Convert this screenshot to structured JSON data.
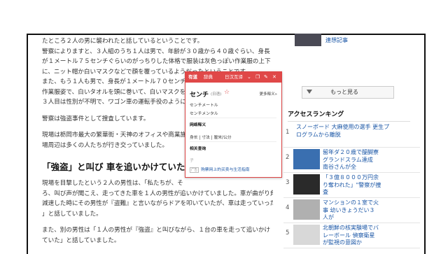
{
  "article": {
    "paragraphs": [
      [
        "たところ２人の男に襲われたと話しているということです。",
        "警察によりますと、３人組のうち１人は男で、年齢が３０歳から４０歳ぐらい、身長",
        "が１メートル７５センチぐらいのがっちりした体格で服装は灰色っぽい作業服の上下",
        "に、ニット帽か白いマスクなどで顔を覆っているようだったということです。",
        "また、もう１人も男で、身長が１メートル７０センチ",
        "作業服姿で、白いタオルを頭に巻いて、白いマスクを",
        "３人目は性別が不明で、ワゴン車の運転手役のように"
      ],
      [
        "警察は強盗事件として捜査しています。"
      ],
      [
        "現場は栃岡市最大の繁華街・天神のオフィスや商業施",
        "場周辺は多くの人たちが行き交っていました。"
      ]
    ],
    "heading": "「強盗」と叫び 車を追いかけていた",
    "paragraphs2": [
      [
        "現場を目撃したという２人の男性は、「私たちが、そ",
        "ろ、叫び声が聞こえ、走ってきた車を１人の男性が追いかけていました。車が曲がり角で",
        "減速した時にその男性が『盗難』と言いながらドアを叩いていたが、車は走っていった",
        "」と話していました。"
      ],
      [
        "また、別の男性は「１人の男性が『強盗』と叫びながら、１台の車を走って追いかけ",
        "ていた」と話していました。"
      ]
    ]
  },
  "sidebar": {
    "top_item_text": "連想記事",
    "more_button": "もっと見る",
    "ranking_title": "アクセスランキング",
    "ranking": [
      {
        "num": "1",
        "text": "スノーボード 大麻使用の選手 更生プ\nログラムから離脱",
        "has_image": false,
        "color": "#ffffff"
      },
      {
        "num": "2",
        "text": "留年ダ２０歳で醍醐寮\nグランドスラム達成\n南谷さんが全",
        "has_image": true,
        "color": "#3a6fb0"
      },
      {
        "num": "3",
        "text": "「３億８０００万円余\nり奪われた」\"警察が捜\n査",
        "has_image": true,
        "color": "#2a2a2a"
      },
      {
        "num": "4",
        "text": "マンションの１室で火\n事 幼いきょうだい３\n人が",
        "has_image": true,
        "color": "#b0b0b0"
      },
      {
        "num": "5",
        "text": "北朝鮮の核実験場でバ\nレーボール 偵察衛星\nが監視の意図か",
        "has_image": true,
        "color": "#d8d8d8"
      }
    ]
  },
  "popup": {
    "tabs": [
      "有道",
      "辞典",
      "日汉互译"
    ],
    "word": "センチ",
    "word_sub": "(日语)",
    "more_link": "更多释义»",
    "senses": [
      "センチメートル",
      "センチメンタル"
    ],
    "section1": "网络释义",
    "section1_items": "身长 | 寸法 | 厘米/公分",
    "section2": "相关查询",
    "hint": "子",
    "ad_tag": "广告",
    "ad_text": "购票网上的买卖与生活指南",
    "head_colors": {
      "bg": "#e04848",
      "text": "#ffffff"
    }
  }
}
